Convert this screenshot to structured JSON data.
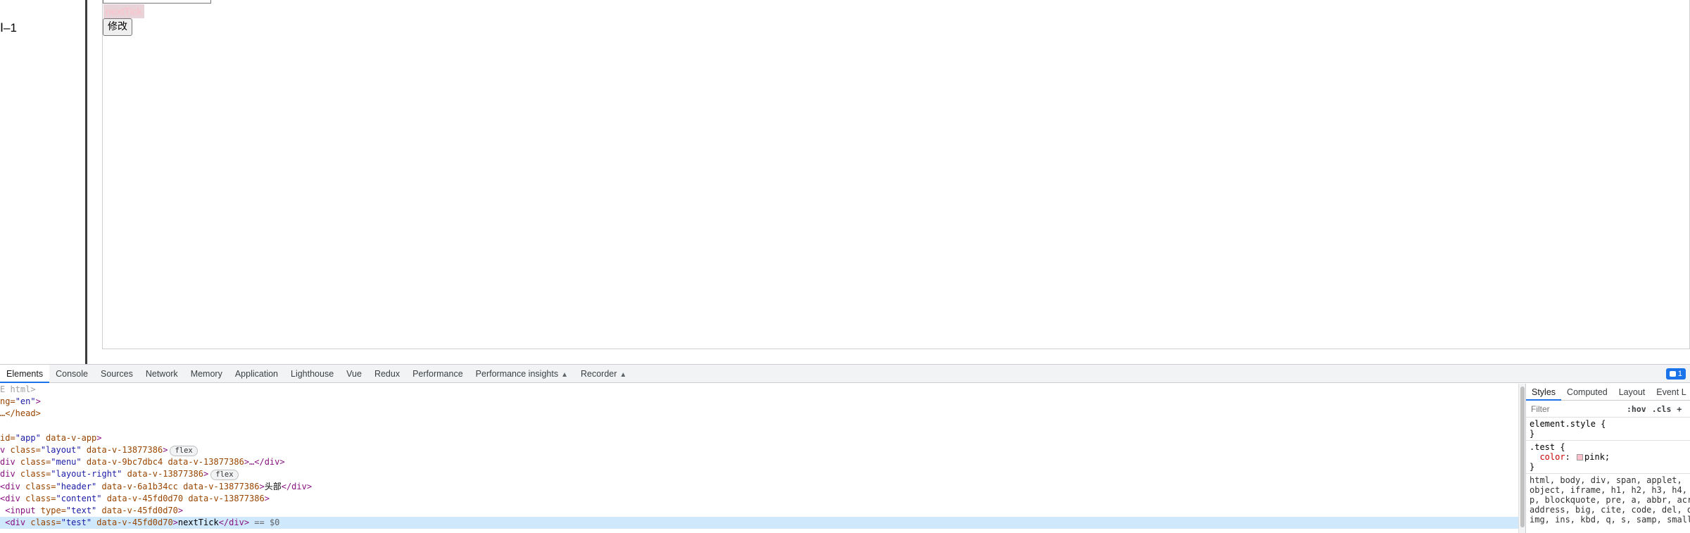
{
  "page": {
    "menu_text": "Ⅰ–1",
    "test_text": "nextTick",
    "edit_button": "修改"
  },
  "devtools": {
    "tabs": [
      "Elements",
      "Console",
      "Sources",
      "Network",
      "Memory",
      "Application",
      "Lighthouse",
      "Vue",
      "Redux",
      "Performance",
      "Performance insights",
      "Recorder"
    ],
    "active_tab": "Elements",
    "issues_count": "1",
    "dom_lines": [
      {
        "text": "E html>",
        "type": "gray"
      },
      {
        "pre": "ng=",
        "val": "\"en\"",
        "post": ">"
      },
      {
        "pre": "…</head>"
      },
      {
        "pre": ""
      },
      {
        "pre": "id=",
        "val": "\"app\"",
        "attr2": " data-v-app",
        "post": ">"
      },
      {
        "tag": "v ",
        "attr": "class=",
        "val": "\"layout\"",
        "attr2": " data-v-13877386",
        "post": ">",
        "badge": "flex"
      },
      {
        "tag": "div ",
        "attr": "class=",
        "val": "\"menu\"",
        "attr2": " data-v-9bc7dbc4 data-v-13877386",
        "post": ">…</div>"
      },
      {
        "tag": "div ",
        "attr": "class=",
        "val": "\"layout-right\"",
        "attr2": " data-v-13877386",
        "post": ">",
        "badge": "flex"
      },
      {
        "tag": "<div ",
        "attr": "class=",
        "val": "\"header\"",
        "attr2": " data-v-6a1b34cc data-v-13877386",
        "post": ">",
        "text": "头部",
        "close": "</div>"
      },
      {
        "tag": "<div ",
        "attr": "class=",
        "val": "\"content\"",
        "attr2": " data-v-45fd0d70 data-v-13877386",
        "post": ">"
      },
      {
        "tag": " <input ",
        "attr": "type=",
        "val": "\"text\"",
        "attr2": " data-v-45fd0d70",
        "post": ">"
      },
      {
        "tag": " <div ",
        "attr": "class=",
        "val": "\"test\"",
        "attr2": " data-v-45fd0d70",
        "post": ">",
        "text": "nextTick",
        "close": "</div>",
        "eq": " == $0",
        "selected": true
      }
    ]
  },
  "styles": {
    "tabs": [
      "Styles",
      "Computed",
      "Layout",
      "Event L"
    ],
    "active_tab": "Styles",
    "filter_placeholder": "Filter",
    "hov": ":hov",
    "cls": ".cls",
    "plus": "+",
    "element_style": "element.style {",
    "close_brace": "}",
    "test_selector": ".test {",
    "test_prop": "color",
    "test_value": "pink;",
    "ua_rule": "html, body, div, span, applet,\nobject, iframe, h1, h2, h3, h4,\np, blockquote, pre, a, abbr, acr\naddress, big, cite, code, del, d\nimg, ins, kbd, q, s, samp, small"
  },
  "colors": {
    "accent": "#1a73e8",
    "test_text_color": "pink",
    "selected_row": "#cfe8fc"
  }
}
